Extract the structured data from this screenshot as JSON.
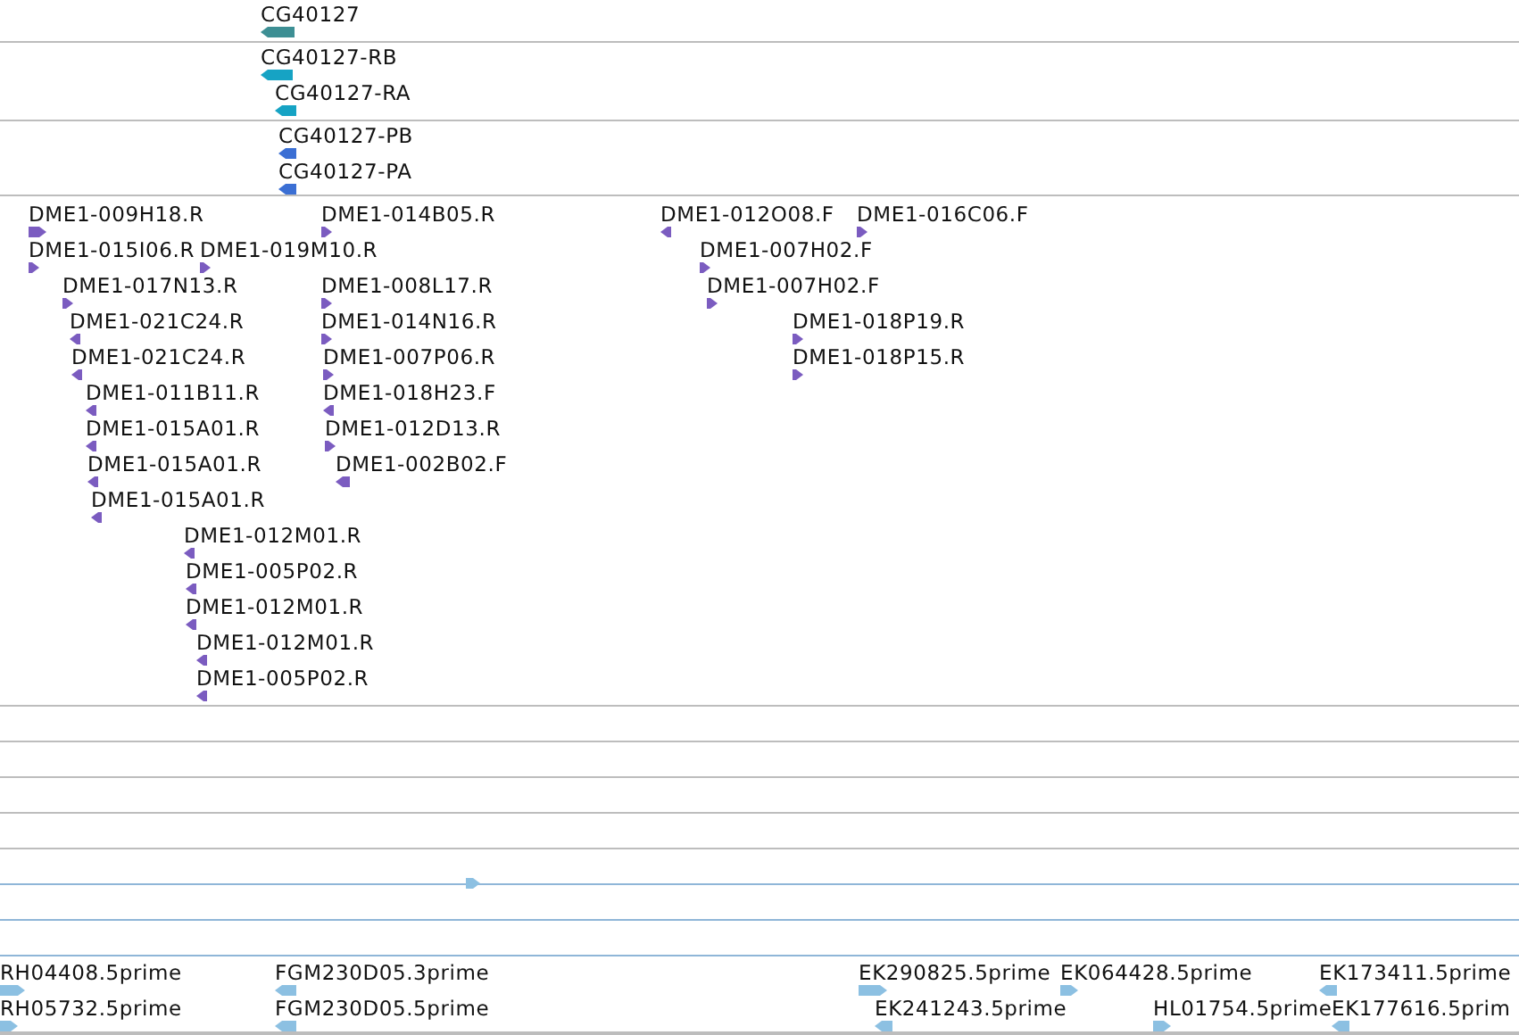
{
  "tracks": [
    {
      "kind": "gene",
      "color": "#3d8f94",
      "features": [
        {
          "label": "CG40127",
          "reverse": true
        }
      ]
    },
    {
      "kind": "transcript",
      "color": "#16a3c4",
      "features": [
        {
          "label": "CG40127-RB",
          "reverse": true
        },
        {
          "label": "CG40127-RA",
          "reverse": true
        }
      ]
    },
    {
      "kind": "transcript",
      "color": "#3b6fd4",
      "features": [
        {
          "label": "CG40127-PB",
          "reverse": true
        },
        {
          "label": "CG40127-PA",
          "reverse": true
        }
      ]
    },
    {
      "kind": "est",
      "color": "#7b5cc0",
      "features": [
        {
          "label": "DME1-009H18.R",
          "reverse": false
        },
        {
          "label": "DME1-014B05.R",
          "reverse": false
        },
        {
          "label": "DME1-012O08.F",
          "reverse": true
        },
        {
          "label": "DME1-016C06.F",
          "reverse": false
        },
        {
          "label": "DME1-015I06.R",
          "reverse": false
        },
        {
          "label": "DME1-019M10.R",
          "reverse": false
        },
        {
          "label": "DME1-007H02.F",
          "reverse": false
        },
        {
          "label": "DME1-017N13.R",
          "reverse": false
        },
        {
          "label": "DME1-008L17.R",
          "reverse": false
        },
        {
          "label": "DME1-007H02.F",
          "reverse": false
        },
        {
          "label": "DME1-021C24.R",
          "reverse": true
        },
        {
          "label": "DME1-014N16.R",
          "reverse": false
        },
        {
          "label": "DME1-018P19.R",
          "reverse": false
        },
        {
          "label": "DME1-021C24.R",
          "reverse": true
        },
        {
          "label": "DME1-007P06.R",
          "reverse": false
        },
        {
          "label": "DME1-018P15.R",
          "reverse": false
        },
        {
          "label": "DME1-011B11.R",
          "reverse": true
        },
        {
          "label": "DME1-018H23.F",
          "reverse": true
        },
        {
          "label": "DME1-015A01.R",
          "reverse": true
        },
        {
          "label": "DME1-012D13.R",
          "reverse": false
        },
        {
          "label": "DME1-015A01.R",
          "reverse": true
        },
        {
          "label": "DME1-002B02.F",
          "reverse": true
        },
        {
          "label": "DME1-015A01.R",
          "reverse": true
        },
        {
          "label": "DME1-012M01.R",
          "reverse": true
        },
        {
          "label": "DME1-005P02.R",
          "reverse": true
        },
        {
          "label": "DME1-012M01.R",
          "reverse": true
        },
        {
          "label": "DME1-012M01.R",
          "reverse": true
        },
        {
          "label": "DME1-005P02.R",
          "reverse": true
        }
      ]
    },
    {
      "kind": "est",
      "color": "#8cc0e2",
      "features": [
        {
          "label": "RH04408.5prime",
          "reverse": false
        },
        {
          "label": "FGM230D05.3prime",
          "reverse": true
        },
        {
          "label": "EK290825.5prime",
          "reverse": false
        },
        {
          "label": "EK064428.5prime",
          "reverse": false
        },
        {
          "label": "EK173411.5prime",
          "reverse": true
        },
        {
          "label": "RH05732.5prime",
          "reverse": false
        },
        {
          "label": "FGM230D05.5prime",
          "reverse": true
        },
        {
          "label": "EK241243.5prime",
          "reverse": true
        },
        {
          "label": "HL01754.5prime",
          "reverse": false
        },
        {
          "label": "EK177616.5prim",
          "reverse": true
        }
      ]
    }
  ]
}
